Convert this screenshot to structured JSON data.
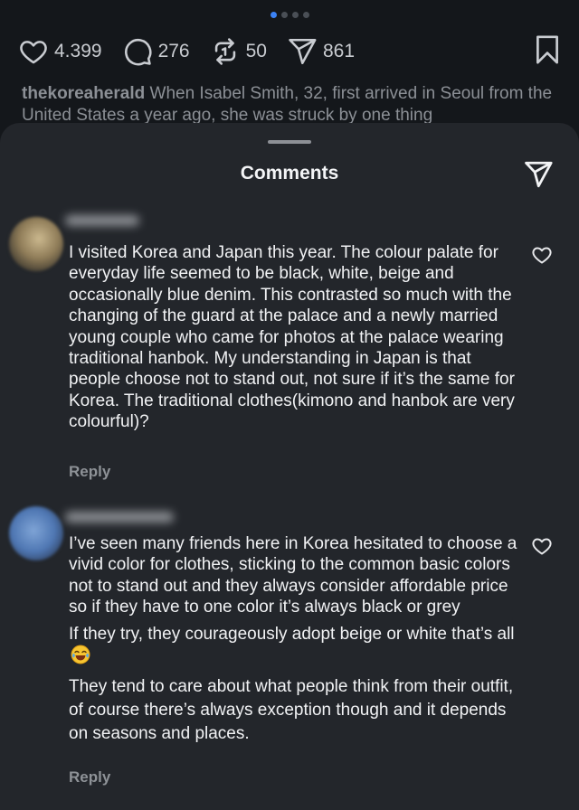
{
  "post": {
    "carousel_count": 4,
    "carousel_active": 0,
    "likes": "4.399",
    "comments": "276",
    "reposts": "50",
    "shares": "861",
    "caption_user": "thekoreaherald",
    "caption_text": "When Isabel Smith, 32, first arrived in Seoul from the United States a year ago, she was struck by one thing"
  },
  "sheet": {
    "title": "Comments"
  },
  "comments": [
    {
      "text": "I visited Korea and Japan this year. The colour palate for everyday life seemed to be  black, white, beige and occasionally blue denim. This contrasted so much with the changing of the guard at the palace and a newly married young couple who came for photos at the palace wearing  traditional hanbok. My understanding in Japan is that people choose not to stand out, not sure if it’s the same for  Korea. The traditional clothes(kimono and hanbok are very colourful)?",
      "reply_label": "Reply"
    },
    {
      "paragraphs": [
        "I’ve seen many friends here in Korea hesitated to choose a vivid color for clothes, sticking to the common basic colors not to stand out and they always consider affordable price  so if they have to one color it’s always black or grey",
        "If they try, they courageously adopt beige or white that’s all",
        "They tend to care about what people think from their outfit, of course there’s always exception though and it depends on seasons and places."
      ],
      "emoji": "laughing-with-tears-emoji",
      "reply_label": "Reply"
    }
  ],
  "colors": {
    "background": "#0e1114",
    "sheet": "#23262b",
    "text": "#f1f2f4",
    "muted": "#8e9297",
    "active_dot": "#3b82f6"
  }
}
